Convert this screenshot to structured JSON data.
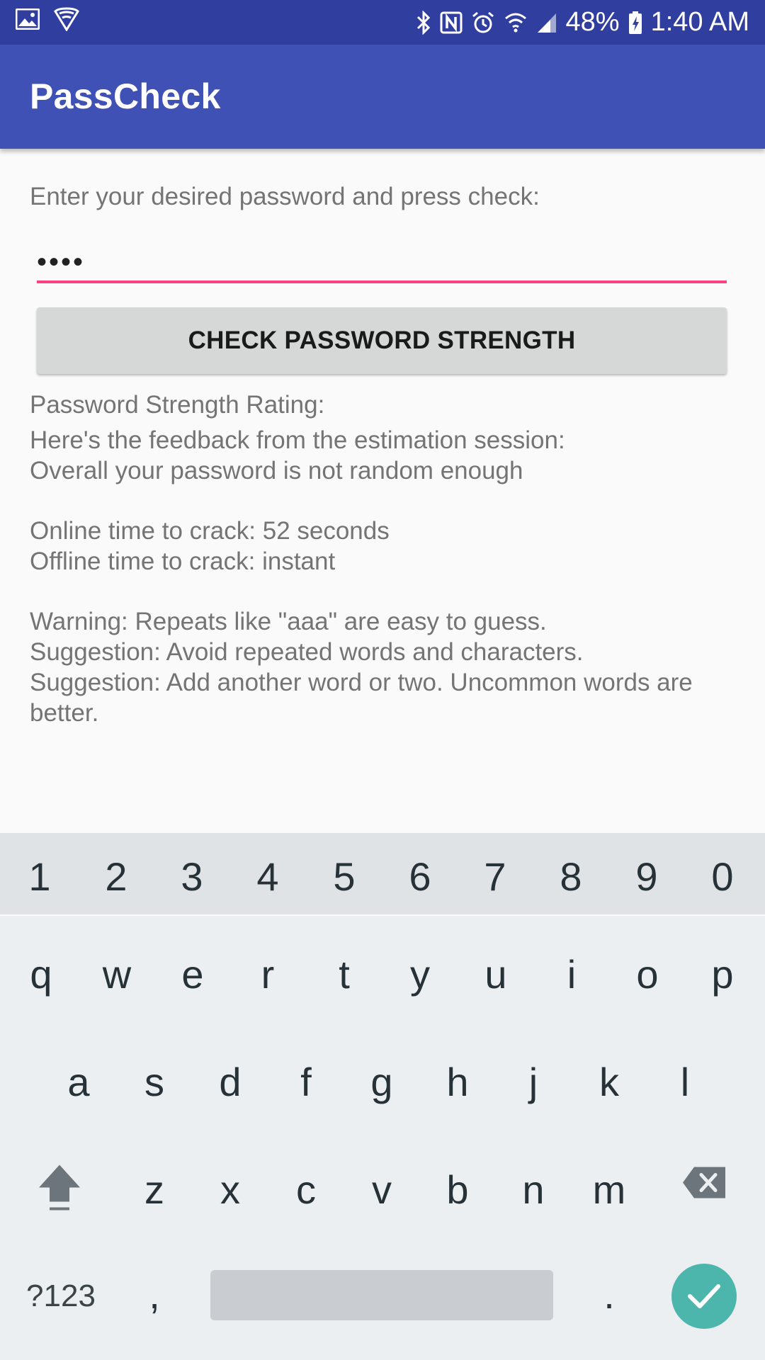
{
  "status_bar": {
    "battery_text": "48%",
    "time": "1:40 AM",
    "icons": [
      "gallery-icon",
      "shield-icon",
      "bluetooth-icon",
      "nfc-icon",
      "alarm-icon",
      "wifi-icon",
      "signal-icon",
      "battery-charging-icon"
    ]
  },
  "app_bar": {
    "title": "PassCheck"
  },
  "form": {
    "prompt": "Enter your desired password and press check:",
    "password_value": "aaaa",
    "button_label": "CHECK PASSWORD STRENGTH"
  },
  "results": {
    "rating_label": "Password Strength Rating:",
    "feedback_lines": [
      "Here's the feedback from the estimation session:",
      "Overall your password is not random enough"
    ],
    "time_lines": [
      "Online time to crack: 52 seconds",
      "Offline time to crack: instant"
    ],
    "advice_lines": [
      "Warning: Repeats like \"aaa\" are easy to guess.",
      "Suggestion: Avoid repeated words and characters.",
      "Suggestion: Add another word or two. Uncommon words are better."
    ]
  },
  "keyboard": {
    "number_row": [
      "1",
      "2",
      "3",
      "4",
      "5",
      "6",
      "7",
      "8",
      "9",
      "0"
    ],
    "row1": [
      "q",
      "w",
      "e",
      "r",
      "t",
      "y",
      "u",
      "i",
      "o",
      "p"
    ],
    "row2": [
      "a",
      "s",
      "d",
      "f",
      "g",
      "h",
      "j",
      "k",
      "l"
    ],
    "row3": [
      "z",
      "x",
      "c",
      "v",
      "b",
      "n",
      "m"
    ],
    "symbols_label": "?123",
    "comma": ",",
    "period": ".",
    "shift_icon": "shift-arrow-icon",
    "backspace_icon": "backspace-icon",
    "enter_icon": "checkmark-icon",
    "accent_color": "#4db6ac"
  },
  "colors": {
    "status_bar": "#303f9f",
    "app_bar": "#3f51b5",
    "input_underline": "#ff4081",
    "button": "#d6d7d7"
  }
}
